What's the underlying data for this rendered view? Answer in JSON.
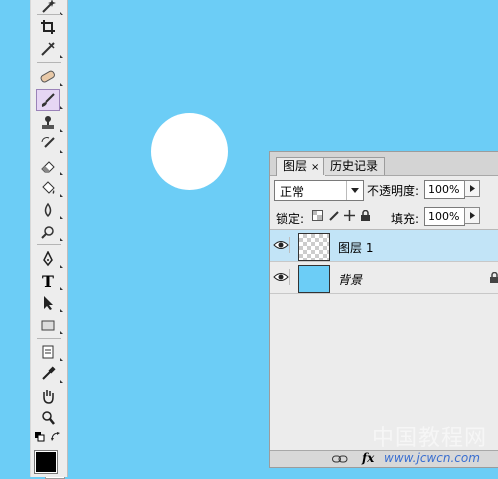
{
  "canvas": {
    "background": "#6ccdf6",
    "shape_color": "#ffffff"
  },
  "toolbox": {
    "tools": [
      {
        "name": "magic-wand-icon"
      },
      {
        "name": "crop-icon"
      },
      {
        "name": "slice-icon"
      },
      {
        "name": "healing-brush-icon"
      },
      {
        "name": "brush-icon",
        "active": true
      },
      {
        "name": "clone-stamp-icon"
      },
      {
        "name": "history-brush-icon"
      },
      {
        "name": "eraser-icon"
      },
      {
        "name": "paint-bucket-icon"
      },
      {
        "name": "blur-icon"
      },
      {
        "name": "dodge-icon"
      },
      {
        "name": "pen-icon"
      },
      {
        "name": "type-tool-icon",
        "glyph": "T"
      },
      {
        "name": "path-selection-icon"
      },
      {
        "name": "rectangle-shape-icon"
      },
      {
        "name": "notes-icon"
      },
      {
        "name": "eyedropper-icon"
      },
      {
        "name": "hand-icon"
      },
      {
        "name": "zoom-icon"
      }
    ],
    "foreground_color": "#000000",
    "background_color": "#ffffff"
  },
  "layers_panel": {
    "tabs": [
      {
        "label": "图层",
        "close": "×"
      },
      {
        "label": "历史记录"
      }
    ],
    "blend_mode": "正常",
    "opacity_label": "不透明度:",
    "opacity_value": "100%",
    "lock_label": "锁定:",
    "fill_label": "填充:",
    "fill_value": "100%",
    "layers": [
      {
        "name": "图层 1",
        "selected": true
      },
      {
        "name": "背景",
        "locked": true
      }
    ],
    "bottom_fx": "fx"
  },
  "watermark": {
    "text": "中国教程网",
    "url": "www.jcwcn.com"
  }
}
